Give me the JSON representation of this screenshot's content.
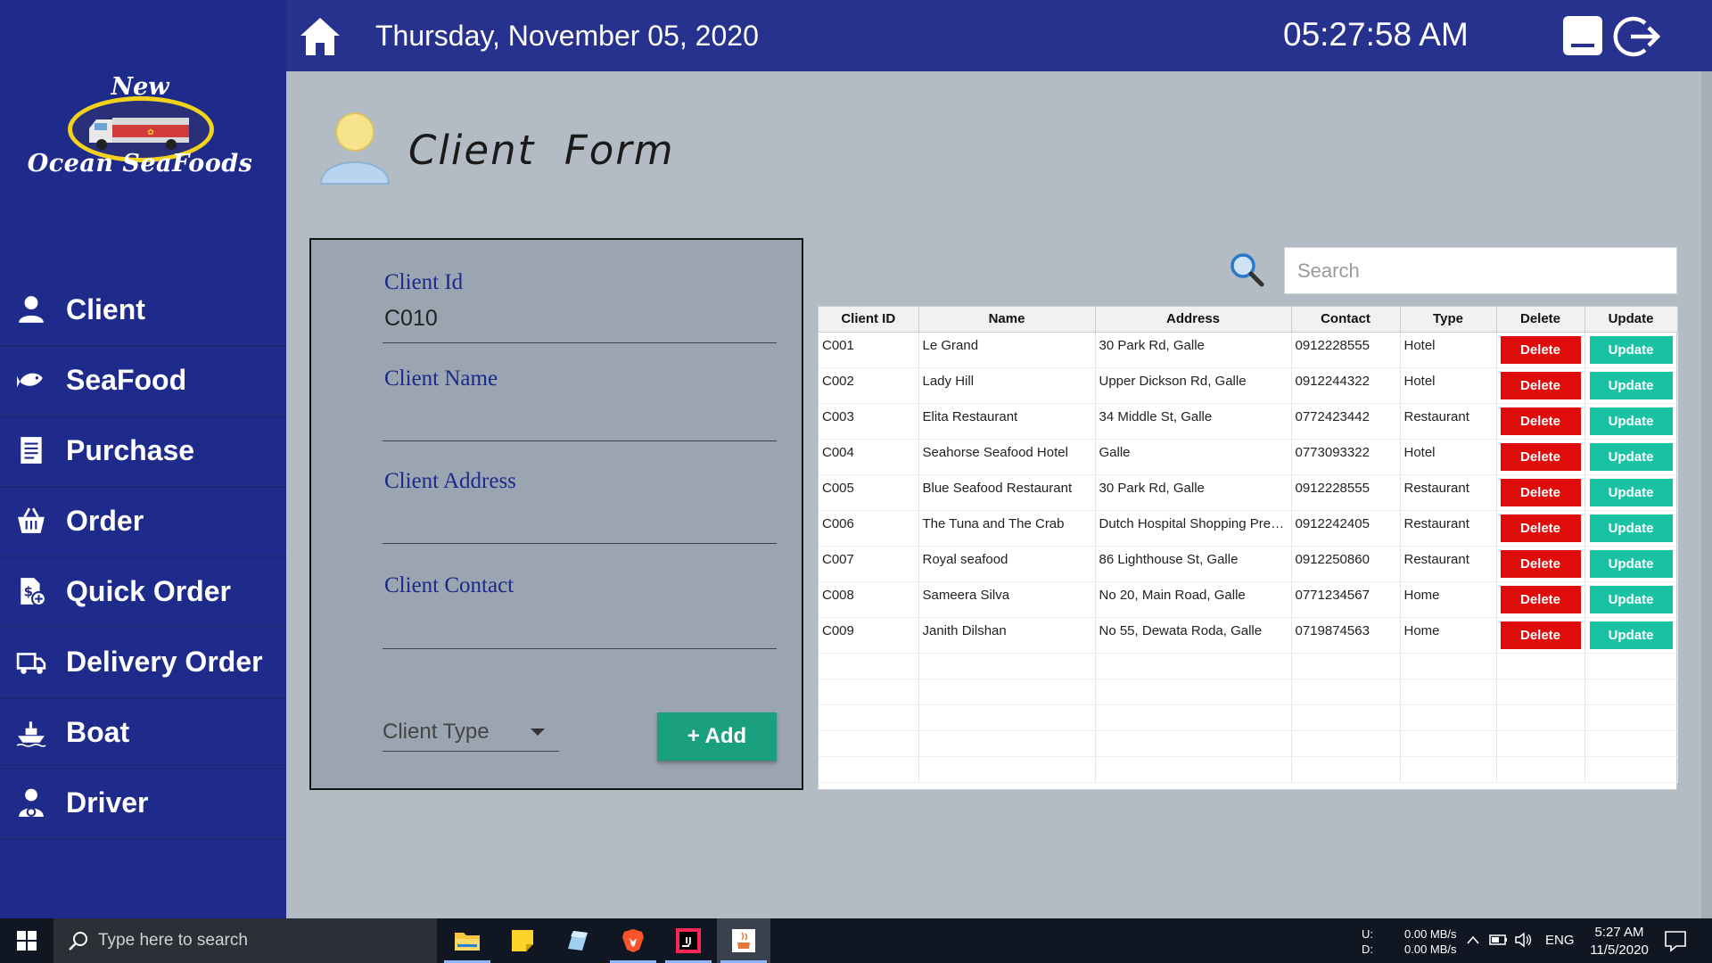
{
  "brand": {
    "line1": "New",
    "line2": "Ocean SeaFoods"
  },
  "header": {
    "date": "Thursday, November 05, 2020",
    "time": "05:27:58 AM"
  },
  "sidebar": {
    "items": [
      {
        "label": "Client",
        "icon": "user-icon"
      },
      {
        "label": "SeaFood",
        "icon": "fish-icon"
      },
      {
        "label": "Purchase",
        "icon": "receipt-icon"
      },
      {
        "label": "Order",
        "icon": "basket-icon"
      },
      {
        "label": "Quick Order",
        "icon": "dollar-document-icon"
      },
      {
        "label": "Delivery Order",
        "icon": "delivery-truck-icon"
      },
      {
        "label": "Boat",
        "icon": "boat-icon"
      },
      {
        "label": "Driver",
        "icon": "driver-icon"
      }
    ]
  },
  "page": {
    "title": "Client  Form"
  },
  "form": {
    "client_id_label": "Client Id",
    "client_id_value": "C010",
    "client_name_label": "Client Name",
    "client_name_value": "",
    "client_address_label": "Client Address",
    "client_address_value": "",
    "client_contact_label": "Client Contact",
    "client_contact_value": "",
    "client_type_placeholder": "Client Type",
    "add_label": "+ Add"
  },
  "search": {
    "placeholder": "Search"
  },
  "table": {
    "columns": [
      "Client ID",
      "Name",
      "Address",
      "Contact",
      "Type",
      "Delete",
      "Update"
    ],
    "delete_label": "Delete",
    "update_label": "Update",
    "rows": [
      {
        "id": "C001",
        "name": "Le Grand",
        "address": "30 Park Rd, Galle",
        "contact": "0912228555",
        "type": "Hotel"
      },
      {
        "id": "C002",
        "name": "Lady Hill",
        "address": "Upper Dickson Rd, Galle",
        "contact": "0912244322",
        "type": "Hotel"
      },
      {
        "id": "C003",
        "name": "Elita Restaurant",
        "address": "34 Middle St, Galle",
        "contact": "0772423442",
        "type": "Restaurant"
      },
      {
        "id": "C004",
        "name": "Seahorse Seafood Hotel",
        "address": "Galle",
        "contact": "0773093322",
        "type": "Hotel"
      },
      {
        "id": "C005",
        "name": "Blue Seafood Restaurant",
        "address": "30 Park Rd, Galle",
        "contact": "0912228555",
        "type": "Restaurant"
      },
      {
        "id": "C006",
        "name": "The Tuna and The Crab",
        "address": "Dutch Hospital Shopping Prec...",
        "contact": "0912242405",
        "type": "Restaurant"
      },
      {
        "id": "C007",
        "name": "Royal seafood",
        "address": "86 Lighthouse St, Galle",
        "contact": "0912250860",
        "type": "Restaurant"
      },
      {
        "id": "C008",
        "name": "Sameera Silva",
        "address": "No 20, Main Road, Galle",
        "contact": "0771234567",
        "type": "Home"
      },
      {
        "id": "C009",
        "name": "Janith Dilshan",
        "address": "No 55, Dewata Roda, Galle",
        "contact": "0719874563",
        "type": "Home"
      }
    ]
  },
  "taskbar": {
    "search_placeholder": "Type here to search",
    "net_up_label": "U:",
    "net_down_label": "D:",
    "net_up": "0.00 MB/s",
    "net_down": "0.00 MB/s",
    "language": "ENG",
    "time": "5:27 AM",
    "date": "11/5/2020"
  },
  "colors": {
    "sidebar": "#1f2b8a",
    "header": "#27318e",
    "background": "#b3bcc4",
    "form_panel": "#9aa5b1",
    "delete": "#e00b0b",
    "update": "#18c2a3",
    "add": "#1aa07e"
  }
}
